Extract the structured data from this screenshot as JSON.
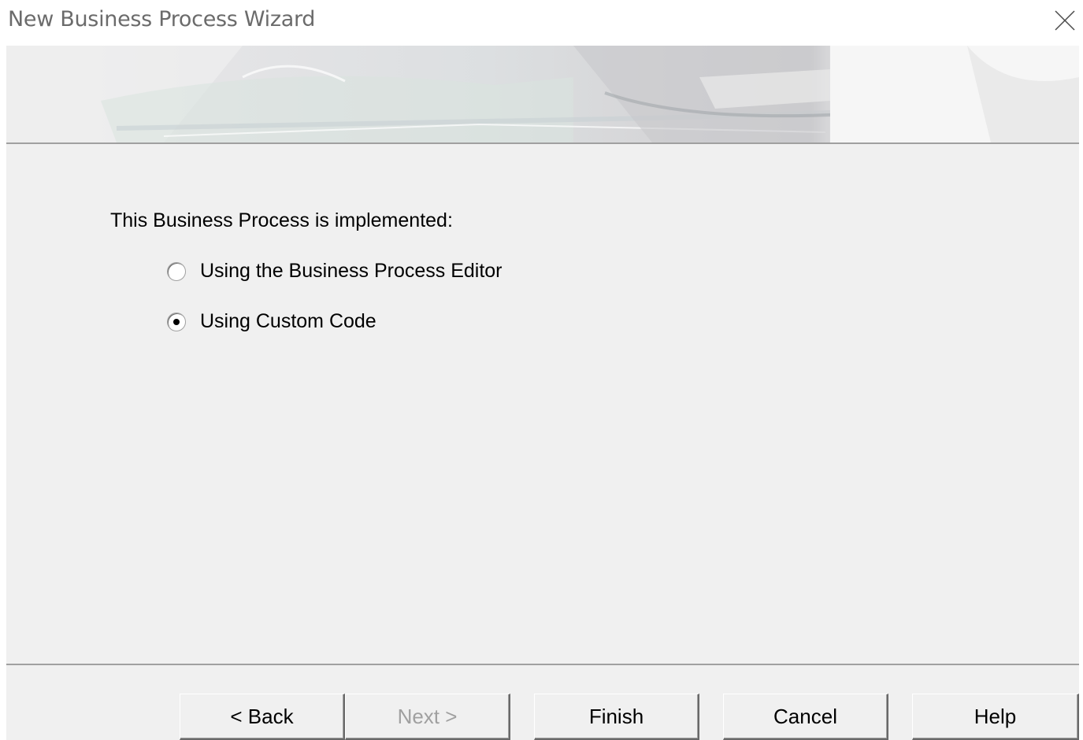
{
  "window": {
    "title": "New Business Process Wizard",
    "close_icon": "close-icon"
  },
  "content": {
    "label": "This Business Process is implemented:",
    "options": [
      {
        "label": "Using the Business Process Editor",
        "selected": false
      },
      {
        "label": "Using Custom Code",
        "selected": true
      }
    ]
  },
  "buttons": {
    "back": "< Back",
    "next": "Next >",
    "finish": "Finish",
    "cancel": "Cancel",
    "help": "Help"
  },
  "colors": {
    "dialog_bg": "#f0f0f0",
    "title_text": "#6b6b6b",
    "disabled_text": "#a0a0a0"
  }
}
